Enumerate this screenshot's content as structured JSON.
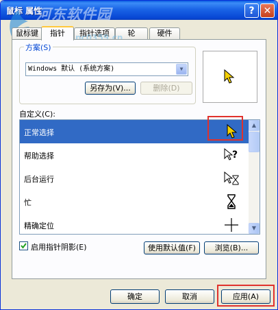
{
  "window": {
    "title": "鼠标 属性",
    "help_glyph": "?",
    "close_glyph": "✕"
  },
  "watermark": {
    "text": "河东软件园",
    "url": "www.pc0359.cn"
  },
  "tabs": [
    {
      "label": "鼠标键"
    },
    {
      "label": "指针"
    },
    {
      "label": "指针选项"
    },
    {
      "label": "轮"
    },
    {
      "label": "硬件"
    }
  ],
  "scheme": {
    "label": "方案(S)",
    "selected": "Windows 默认 (系统方案)",
    "save_as": "另存为(V)...",
    "delete": "删除(D)"
  },
  "custom": {
    "label": "自定义(C):",
    "items": [
      {
        "label": "正常选择",
        "icon": "arrow-cursor-icon"
      },
      {
        "label": "帮助选择",
        "icon": "help-cursor-icon"
      },
      {
        "label": "后台运行",
        "icon": "working-in-background-cursor-icon"
      },
      {
        "label": "忙",
        "icon": "hourglass-cursor-icon"
      },
      {
        "label": "精确定位",
        "icon": "crosshair-cursor-icon"
      }
    ]
  },
  "shadow": {
    "label": "启用指针阴影(E)",
    "checked": true
  },
  "buttons": {
    "use_default": "使用默认值(F)",
    "browse": "浏览(B)...",
    "ok": "确定",
    "cancel": "取消",
    "apply": "应用(A)"
  },
  "colors": {
    "titlebar": "#0a50d8",
    "selection": "#316ac5",
    "highlight": "#e0312c",
    "face": "#ece9d8"
  }
}
